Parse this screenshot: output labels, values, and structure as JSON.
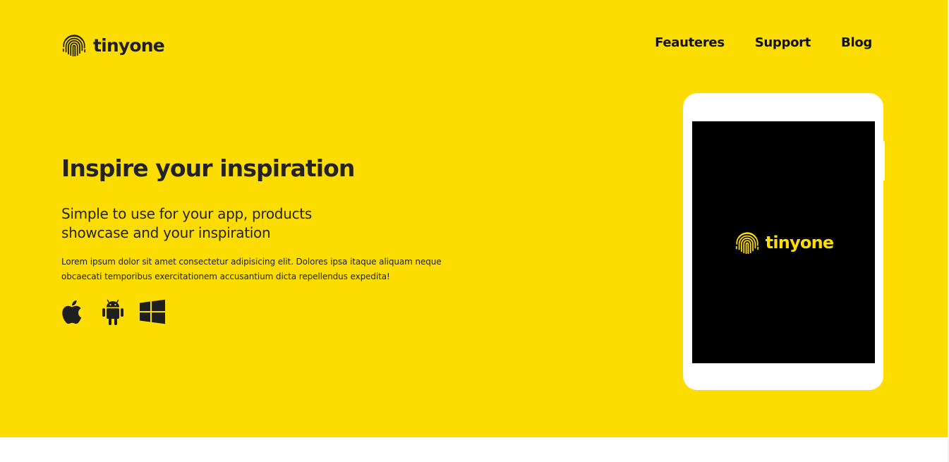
{
  "brand": {
    "name": "tinyone",
    "icon": "fingerprint-icon",
    "accent_color": "#fddc00",
    "text_color": "#1f1f1f"
  },
  "nav": {
    "items": [
      {
        "label": "Feauteres"
      },
      {
        "label": "Support"
      },
      {
        "label": "Blog"
      }
    ]
  },
  "hero": {
    "title": "Inspire your inspiration",
    "subtitle_line1": "Simple to use for your app, products",
    "subtitle_line2": "showcase and your inspiration",
    "body": "Lorem ipsum dolor sit amet consectetur adipisicing elit. Dolores ipsa itaque aliquam neque obcaecati temporibus exercitationem accusantium dicta repellendus expedita!",
    "platforms": [
      {
        "icon": "apple-icon"
      },
      {
        "icon": "android-icon"
      },
      {
        "icon": "windows-icon"
      }
    ]
  },
  "device": {
    "screen_logo_text": "tinyone",
    "screen_background": "#000000"
  }
}
